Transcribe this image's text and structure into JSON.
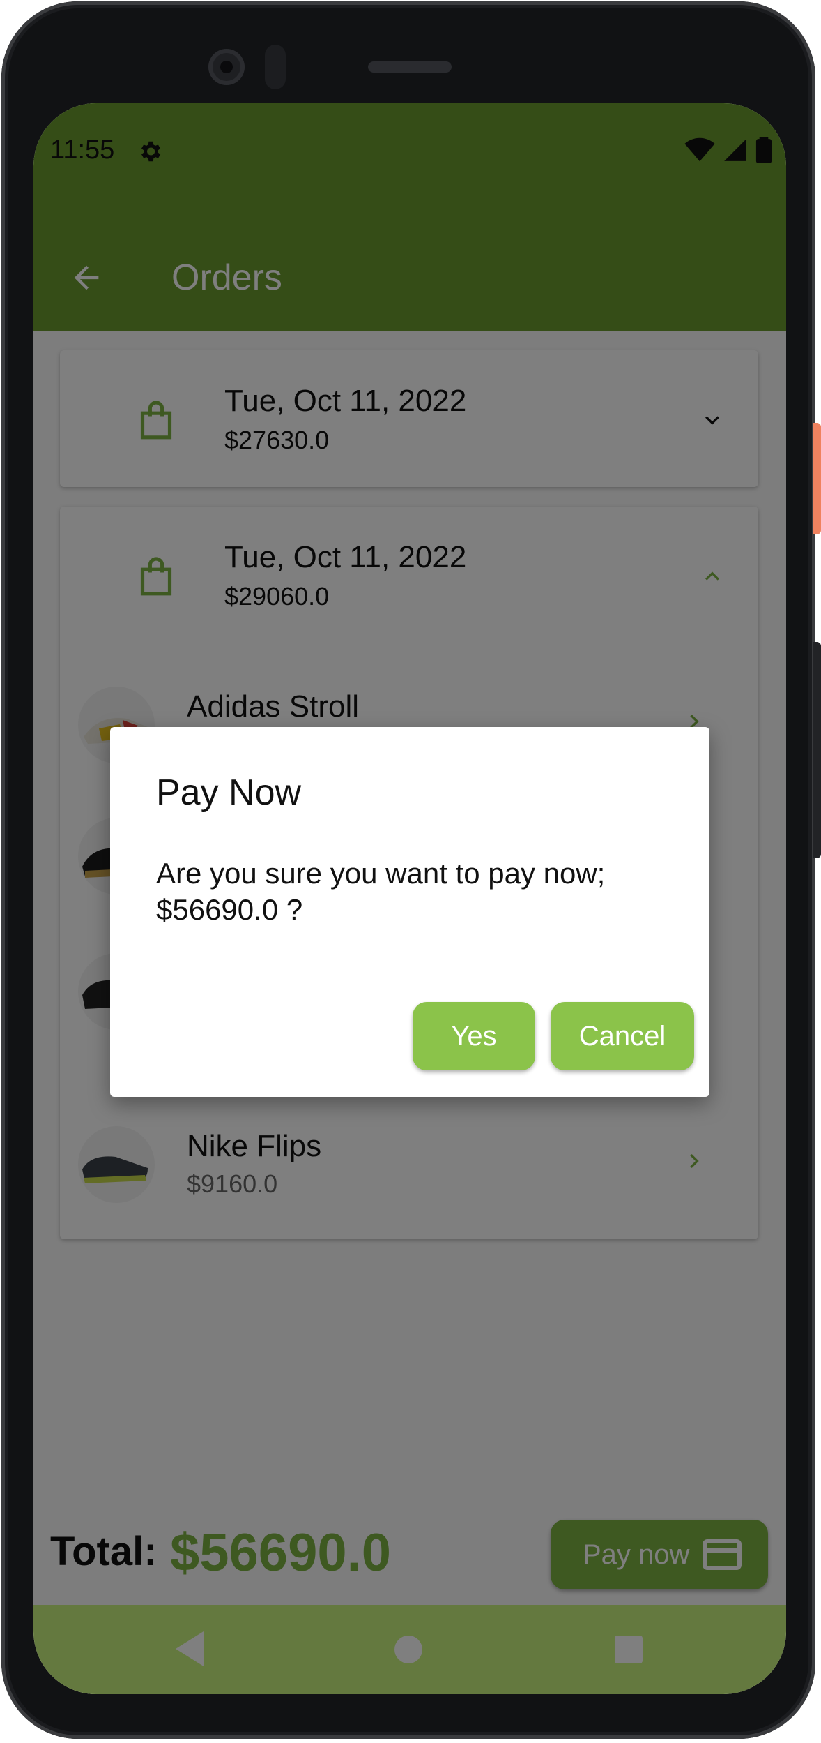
{
  "status_bar": {
    "time": "11:55"
  },
  "app_bar": {
    "title": "Orders"
  },
  "orders": [
    {
      "date": "Tue, Oct 11, 2022",
      "amount": "$27630.0",
      "expanded": false
    },
    {
      "date": "Tue, Oct 11, 2022",
      "amount": "$29060.0",
      "expanded": true,
      "items": [
        {
          "name": "Adidas Stroll",
          "price": ""
        },
        {
          "name": "Nike Flips",
          "price": "$9160.0"
        }
      ]
    }
  ],
  "footer": {
    "total_label": "Total:",
    "total_value": "$56690.0",
    "pay_button": "Pay now"
  },
  "dialog": {
    "title": "Pay Now",
    "body": "Are you sure you want to pay now; $56690.0 ?",
    "yes": "Yes",
    "cancel": "Cancel"
  },
  "colors": {
    "primary": "#6b9b2e",
    "accent": "#8bc34a",
    "nav": "#c8f27e"
  },
  "icons": [
    "settings-icon",
    "wifi-icon",
    "signal-icon",
    "battery-icon",
    "back-arrow-icon",
    "shopping-bag-icon",
    "chevron-down-icon",
    "chevron-up-icon",
    "chevron-right-icon",
    "credit-card-icon",
    "nav-back-icon",
    "nav-home-icon",
    "nav-recent-icon"
  ]
}
